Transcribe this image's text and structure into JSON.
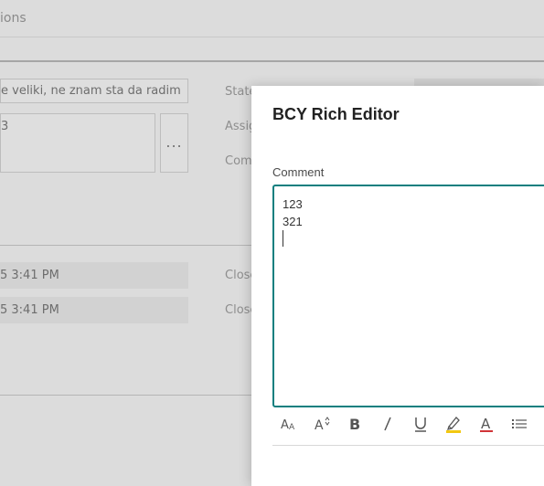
{
  "background": {
    "topbar_text": "ions",
    "description_value": "e veliki, ne znam sta da radim",
    "textarea_value": "3",
    "ellipsis": "...",
    "labels": [
      "State",
      "Assig",
      "Com"
    ],
    "date_fields": [
      "5 3:41 PM",
      "5 3:41 PM"
    ],
    "close_labels": [
      "Close",
      "Close"
    ]
  },
  "dialog": {
    "title": "BCY Rich Editor",
    "comment_label": "Comment",
    "editor_lines": [
      "123",
      "321"
    ]
  },
  "toolbar": {
    "buttons": [
      "font-size-icon",
      "grow-font-icon",
      "bold-icon",
      "italic-icon",
      "underline-icon",
      "highlight-icon",
      "font-color-icon",
      "bullet-list-icon"
    ],
    "highlight_color": "#f2c811",
    "font_color": "#d13438"
  },
  "colors": {
    "accent": "#0f7f7f"
  }
}
